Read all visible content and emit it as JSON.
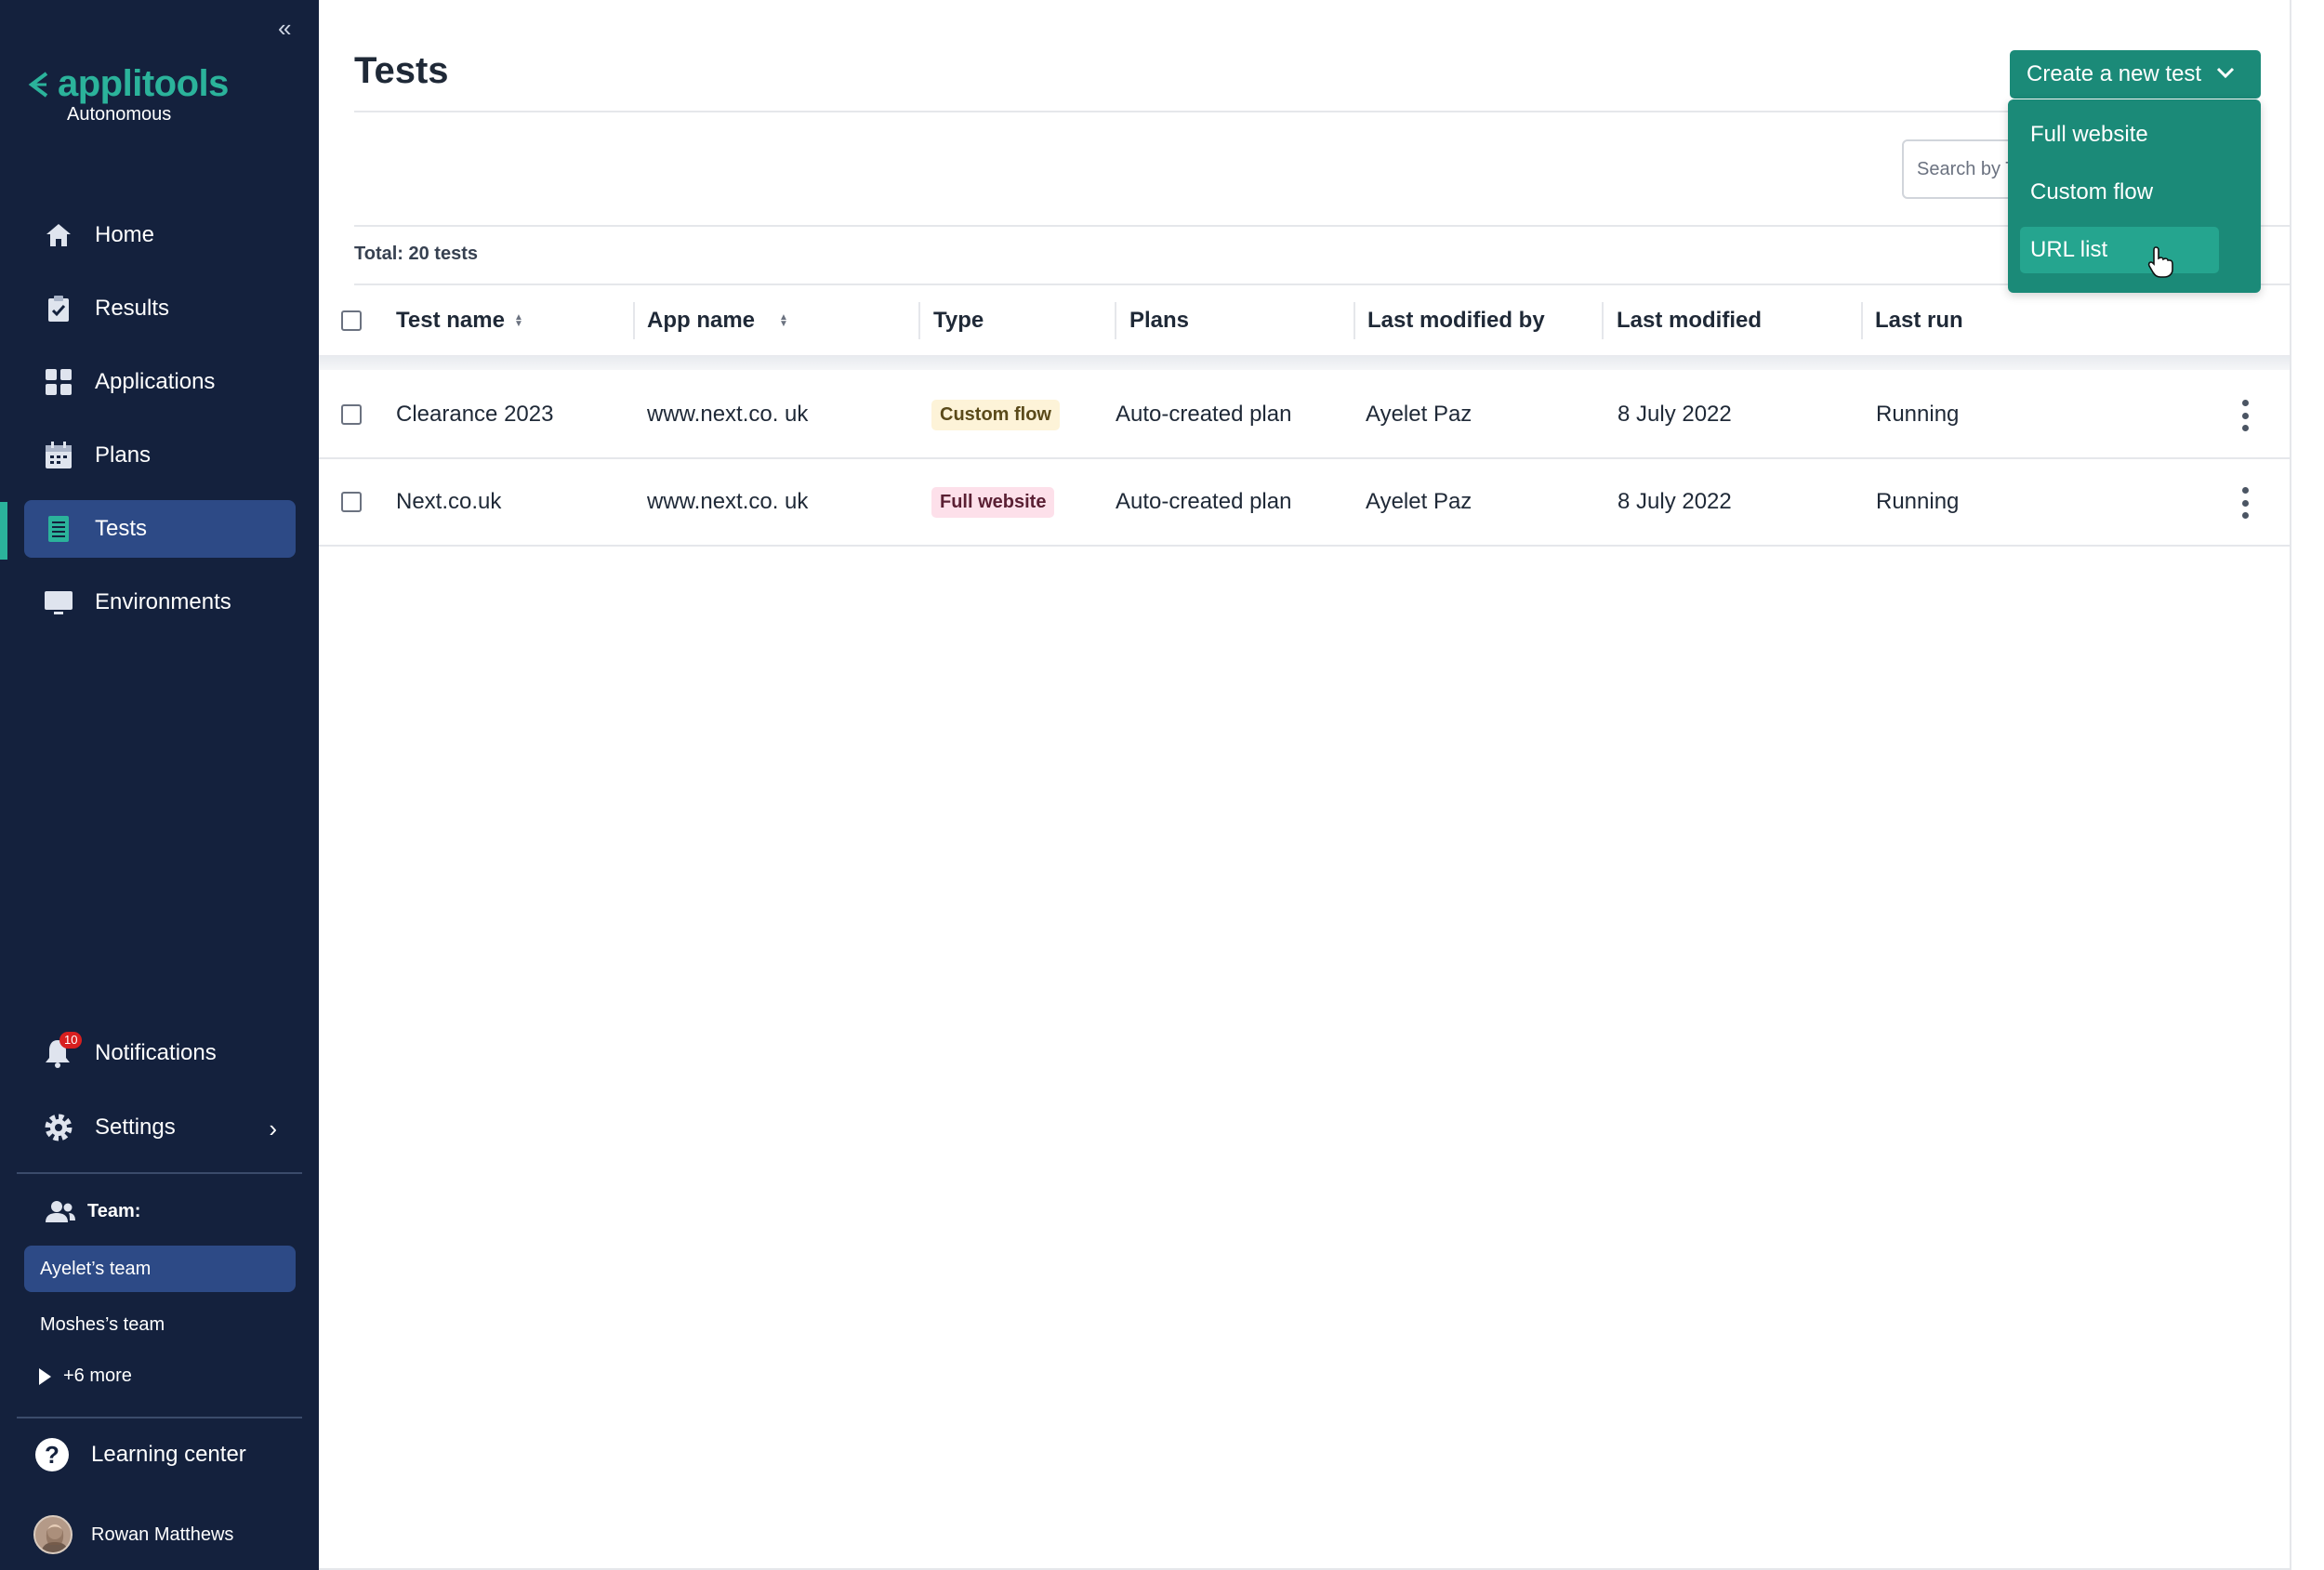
{
  "sidebar": {
    "logo_text": "applitools",
    "logo_sub": "Autonomous",
    "items": [
      {
        "label": "Home",
        "icon": "home-icon"
      },
      {
        "label": "Results",
        "icon": "clipboard-check-icon"
      },
      {
        "label": "Applications",
        "icon": "grid-icon"
      },
      {
        "label": "Plans",
        "icon": "calendar-icon"
      },
      {
        "label": "Tests",
        "icon": "list-icon",
        "active": true
      },
      {
        "label": "Environments",
        "icon": "monitor-icon"
      }
    ],
    "notifications": {
      "label": "Notifications",
      "count": "10"
    },
    "settings": {
      "label": "Settings"
    },
    "team": {
      "header": "Team:",
      "items": [
        "Ayelet’s team",
        "Moshes’s team"
      ],
      "more": "+6 more"
    },
    "learning": "Learning center",
    "user": "Rowan Matthews"
  },
  "page": {
    "title": "Tests",
    "search_placeholder": "Search by T",
    "total": "Total: 20 tests",
    "create_button": "Create a new test",
    "create_menu": [
      "Full website",
      "Custom flow",
      "URL list"
    ],
    "create_menu_hover_index": 2
  },
  "table": {
    "columns": [
      "Test name",
      "App name",
      "Type",
      "Plans",
      "Last modified by",
      "Last modified",
      "Last run"
    ],
    "rows": [
      {
        "test_name": "Clearance 2023",
        "app_name": "www.next.co. uk",
        "type": "Custom flow",
        "plans": "Auto-created plan",
        "modified_by": "Ayelet Paz",
        "modified": "8 July 2022",
        "last_run": "Running"
      },
      {
        "test_name": "Next.co.uk",
        "app_name": "www.next.co. uk",
        "type": "Full website",
        "plans": "Auto-created plan",
        "modified_by": "Ayelet Paz",
        "modified": "8 July 2022",
        "last_run": "Running"
      }
    ]
  },
  "colors": {
    "sidebar_bg": "#14213d",
    "accent": "#1b8a78",
    "brand": "#2bb39b",
    "active_nav": "#2d4a86"
  }
}
